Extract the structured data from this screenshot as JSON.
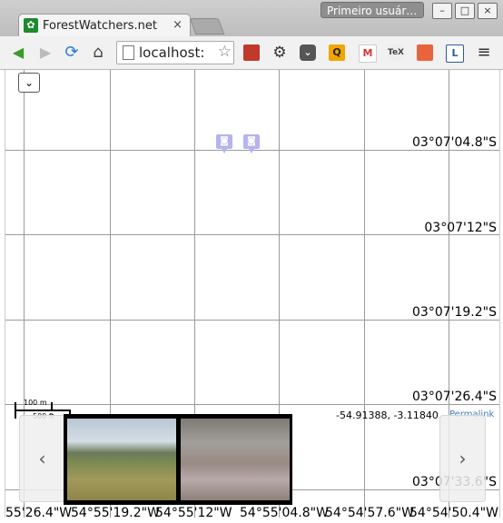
{
  "window": {
    "tab_title": "ForestWatchers.net",
    "tab_close": "×",
    "profile_label": "Primeiro usuár…",
    "buttons": {
      "minimize": "–",
      "maximize": "□",
      "close": "×"
    }
  },
  "toolbar": {
    "back": "◀",
    "forward": "▶",
    "reload": "⟳",
    "home": "⌂",
    "url": "localhost:",
    "star": "☆",
    "menu": "≡",
    "extension_icons": [
      "red-book-icon",
      "gear-icon",
      "pocket-icon",
      "q-icon",
      "gmail-icon",
      "tex-icon",
      "eraser-icon",
      "bookmark-icon",
      "clipboard-icon"
    ]
  },
  "map": {
    "dropdown": "⌄",
    "latitudes": [
      "03°07'04.8\"S",
      "03°07'12\"S",
      "03°07'19.2\"S",
      "03°07'26.4\"S",
      "03°07'33.6\"S"
    ],
    "longitudes": [
      "55'26.4\"W",
      "54°55'19.2\"W",
      "54°55'12\"W",
      "54°55'04.8\"W",
      "54°54'57.6\"W",
      "54°54'50.4\"W"
    ],
    "scale": {
      "metric": "100 m",
      "imperial": "500 ft"
    },
    "cursor_coords": "-54.91388, -3.11840",
    "permalink": "Permalink",
    "marker_icon": "camera-icon",
    "nav_prev": "‹",
    "nav_next": "›"
  },
  "colors": {
    "favicon": "#1e8a2e",
    "marker": "#b6b3f0",
    "permalink": "#3a7dc2",
    "grid": "#9a9a9a"
  }
}
